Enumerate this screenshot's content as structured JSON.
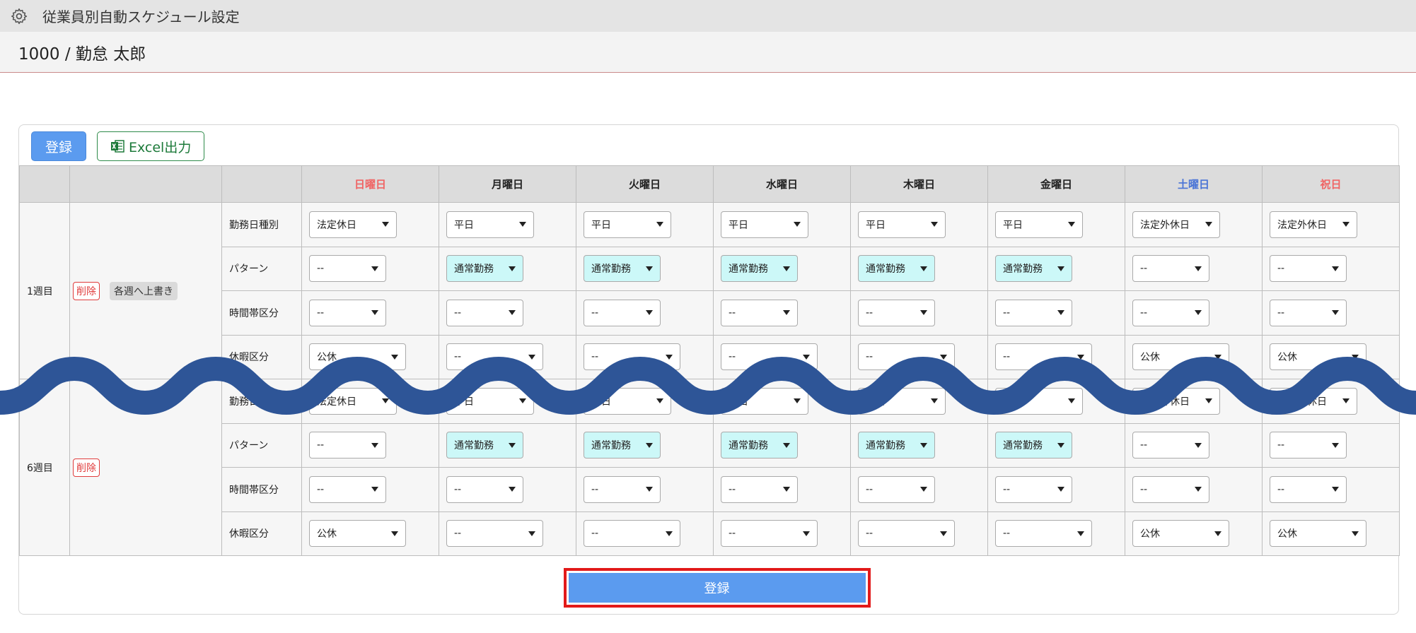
{
  "header": {
    "title": "従業員別自動スケジュール設定",
    "icon": "gear-icon"
  },
  "employee": {
    "label": "1000 / 勤怠 太郎"
  },
  "toolbar": {
    "register_label": "登録",
    "excel_label": "Excel出力"
  },
  "table": {
    "days": [
      {
        "label": "日曜日",
        "color": "#f06464"
      },
      {
        "label": "月曜日",
        "color": "#222222"
      },
      {
        "label": "火曜日",
        "color": "#222222"
      },
      {
        "label": "水曜日",
        "color": "#222222"
      },
      {
        "label": "木曜日",
        "color": "#222222"
      },
      {
        "label": "金曜日",
        "color": "#222222"
      },
      {
        "label": "土曜日",
        "color": "#4a74d6"
      },
      {
        "label": "祝日",
        "color": "#f06464"
      }
    ],
    "row_labels": [
      "勤務日種別",
      "パターン",
      "時間帯区分",
      "休暇区分"
    ],
    "weeks": [
      {
        "week_label": "1週目",
        "delete_label": "削除",
        "overwrite_label": "各週へ上書き",
        "rows": [
          [
            "法定休日",
            "平日",
            "平日",
            "平日",
            "平日",
            "平日",
            "法定外休日",
            "法定外休日"
          ],
          [
            "--",
            "通常勤務",
            "通常勤務",
            "通常勤務",
            "通常勤務",
            "通常勤務",
            "--",
            "--"
          ],
          [
            "--",
            "--",
            "--",
            "--",
            "--",
            "--",
            "--",
            "--"
          ],
          [
            "公休",
            "--",
            "--",
            "--",
            "--",
            "--",
            "公休",
            "公休"
          ]
        ]
      },
      {
        "week_label": "6週目",
        "delete_label": "削除",
        "rows": [
          [
            "法定休日",
            "平日",
            "平日",
            "平日",
            "平日",
            "平日",
            "法定外休日",
            "法定外休日"
          ],
          [
            "--",
            "通常勤務",
            "通常勤務",
            "通常勤務",
            "通常勤務",
            "通常勤務",
            "--",
            "--"
          ],
          [
            "--",
            "--",
            "--",
            "--",
            "--",
            "--",
            "--",
            "--"
          ],
          [
            "公休",
            "--",
            "--",
            "--",
            "--",
            "--",
            "公休",
            "公休"
          ]
        ]
      }
    ]
  },
  "footer": {
    "register_label": "登録"
  },
  "colors": {
    "primary": "#5b9bef",
    "highlight_border": "#e21a1a",
    "pattern_fill": "#ccf8f8",
    "wave": "#2e5597"
  }
}
